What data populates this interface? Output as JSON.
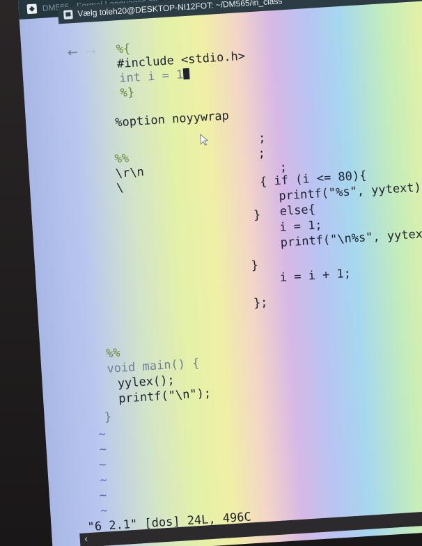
{
  "outer_window": {
    "title": "DM565 - Formal Languages an"
  },
  "terminal": {
    "title": "Vælg toleh20@DESKTOP-NI12FOT: ~/DM565/in_class"
  },
  "editor": {
    "lines": [
      {
        "text": "%{"
      },
      {
        "text": "#include <stdio.h>"
      },
      {
        "text": "int i = 1"
      },
      {
        "text": "%}"
      },
      {
        "text": "%option noyywrap"
      },
      {
        "text": "%%"
      },
      {
        "text": "\\r\\n"
      },
      {
        "text": "\\"
      },
      {
        "text": ";"
      },
      {
        "text": ";"
      },
      {
        "text": ";"
      },
      {
        "text": "{ if (i <= 80){"
      },
      {
        "text": "printf(\"%s\", yytext);"
      },
      {
        "text": "}"
      },
      {
        "text": "else{"
      },
      {
        "text": "i = 1;"
      },
      {
        "text": "printf(\"\\n%s\", yytext);"
      },
      {
        "text": "}"
      },
      {
        "text": "i = i + 1;"
      },
      {
        "text": "};"
      },
      {
        "text": "%%"
      },
      {
        "text": "void main() {"
      },
      {
        "text": "yylex();"
      },
      {
        "text": "printf(\"\\n\");"
      },
      {
        "text": "}"
      }
    ],
    "tildes": [
      "~",
      "~",
      "~",
      "~",
      "~",
      "~"
    ],
    "status_line": "\"6 2.1\" [dos] 24L, 496C"
  },
  "icons": {
    "back": "arrow-left-icon",
    "forward": "arrow-right-icon",
    "scroll_left": "chevron-left-icon"
  }
}
